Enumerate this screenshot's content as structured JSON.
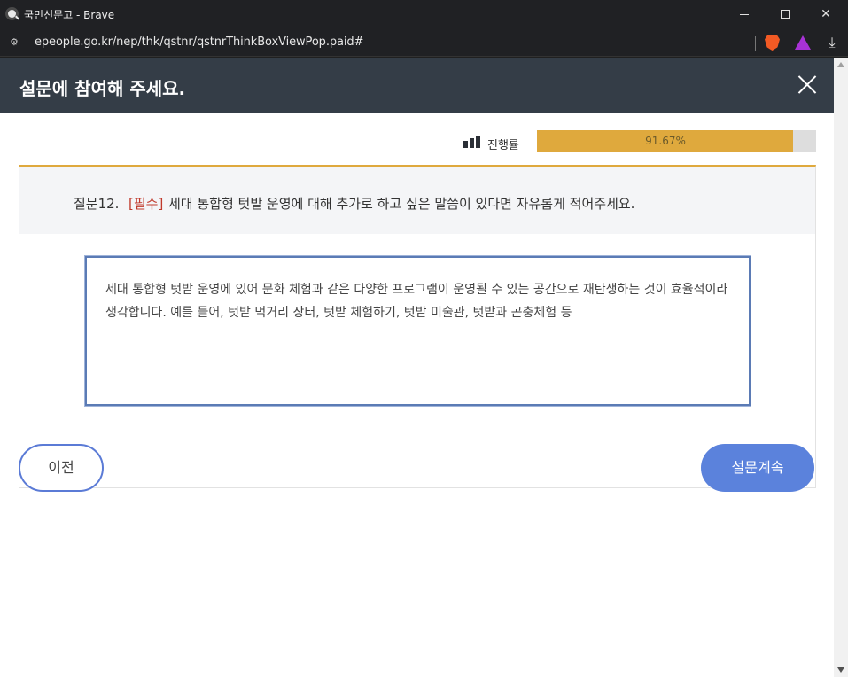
{
  "window": {
    "title": "국민신문고 - Brave",
    "url": "epeople.go.kr/nep/thk/qstnr/qstnrThinkBoxViewPop.paid#"
  },
  "popup": {
    "title": "설문에 참여해 주세요."
  },
  "progress": {
    "label": "진행률",
    "value_text": "91.67%",
    "value": 91.67
  },
  "question": {
    "number": "질문12.",
    "required": "[필수]",
    "text": "세대 통합형 텃밭 운영에 대해 추가로 하고 싶은 말씀이 있다면 자유롭게 적어주세요."
  },
  "answer": {
    "value": "세대 통합형 텃밭 운영에 있어 문화 체험과 같은 다양한 프로그램이 운영될 수 있는 공간으로 재탄생하는 것이 효율적이라 생각합니다. 예를 들어, 텃밭 먹거리 장터, 텃밭 체험하기, 텃밭 미술관, 텃밭과 곤충체험 등"
  },
  "buttons": {
    "prev": "이전",
    "next": "설문계속"
  },
  "colors": {
    "header_bg": "#343d47",
    "accent_gold": "#dfa93d",
    "button_blue": "#5b82dc"
  }
}
